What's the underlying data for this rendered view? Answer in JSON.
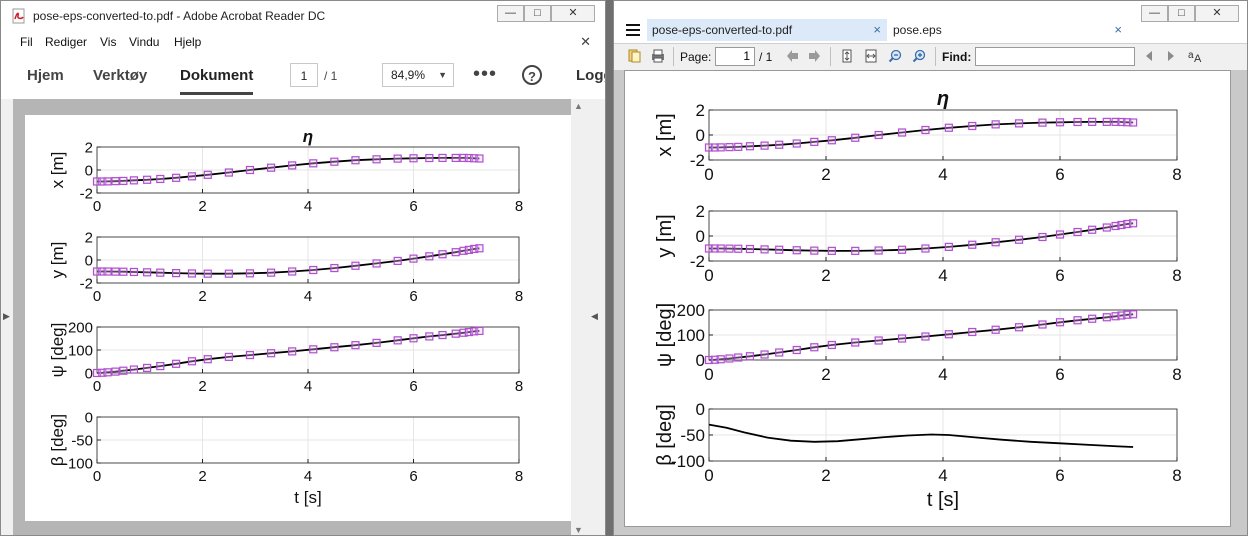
{
  "acrobat": {
    "title": "pose-eps-converted-to.pdf - Adobe Acrobat Reader DC",
    "menu": [
      "Fil",
      "Rediger",
      "Vis",
      "Vindu",
      "Hjelp"
    ],
    "nav": {
      "home": "Hjem",
      "tools": "Verktøy",
      "document": "Dokument"
    },
    "page_current": "1",
    "page_total": "/ 1",
    "zoom": "84,9%",
    "more": "•••",
    "help": "?",
    "login": "Logg"
  },
  "sumatra": {
    "tabs": [
      {
        "label": "pose-eps-converted-to.pdf",
        "close": "×"
      },
      {
        "label": "pose.eps",
        "close": "×"
      }
    ],
    "toolbar": {
      "page_label": "Page:",
      "page_current": "1",
      "page_total": "/ 1",
      "find_label": "Find:"
    }
  },
  "window_buttons": {
    "minimize": "—",
    "restore": "□",
    "close": "✕"
  },
  "colors": {
    "series_line": "#000000",
    "marker": "#b04fd0",
    "grid": "#e6e6e6"
  },
  "chart_data": [
    {
      "type": "line",
      "title": "η",
      "ylabel": "x [m]",
      "xlim": [
        0,
        8
      ],
      "ylim": [
        -2,
        2
      ],
      "xticks": [
        "0",
        "2",
        "4",
        "6",
        "8"
      ],
      "yticks": [
        "-2",
        "0",
        "2"
      ],
      "series": [
        {
          "x": [
            0,
            0.1,
            0.2,
            0.35,
            0.5,
            0.7,
            0.95,
            1.2,
            1.5,
            1.8,
            2.1,
            2.5,
            2.9,
            3.3,
            3.7,
            4.1,
            4.5,
            4.9,
            5.3,
            5.7,
            6.0,
            6.3,
            6.55,
            6.8,
            6.95,
            7.05,
            7.15,
            7.25
          ],
          "y": [
            -1.0,
            -1.0,
            -0.99,
            -0.97,
            -0.95,
            -0.9,
            -0.85,
            -0.78,
            -0.68,
            -0.55,
            -0.42,
            -0.22,
            0.0,
            0.2,
            0.4,
            0.58,
            0.72,
            0.85,
            0.93,
            0.99,
            1.02,
            1.04,
            1.05,
            1.05,
            1.05,
            1.04,
            1.02,
            1.0
          ]
        }
      ]
    },
    {
      "type": "line",
      "ylabel": "y [m]",
      "xlim": [
        0,
        8
      ],
      "ylim": [
        -2,
        2
      ],
      "xticks": [
        "0",
        "2",
        "4",
        "6",
        "8"
      ],
      "yticks": [
        "-2",
        "0",
        "2"
      ],
      "series": [
        {
          "x": [
            0,
            0.1,
            0.2,
            0.35,
            0.5,
            0.7,
            0.95,
            1.2,
            1.5,
            1.8,
            2.1,
            2.5,
            2.9,
            3.3,
            3.7,
            4.1,
            4.5,
            4.9,
            5.3,
            5.7,
            6.0,
            6.3,
            6.55,
            6.8,
            6.95,
            7.05,
            7.15,
            7.25
          ],
          "y": [
            -1.0,
            -1.0,
            -1.0,
            -1.01,
            -1.02,
            -1.04,
            -1.07,
            -1.1,
            -1.14,
            -1.17,
            -1.19,
            -1.19,
            -1.16,
            -1.1,
            -1.0,
            -0.87,
            -0.7,
            -0.5,
            -0.3,
            -0.08,
            0.12,
            0.32,
            0.5,
            0.68,
            0.8,
            0.88,
            0.96,
            1.02
          ]
        }
      ]
    },
    {
      "type": "line",
      "ylabel": "ψ [deg]",
      "xlim": [
        0,
        8
      ],
      "ylim": [
        0,
        200
      ],
      "xticks": [
        "0",
        "2",
        "4",
        "6",
        "8"
      ],
      "yticks": [
        "0",
        "100",
        "200"
      ],
      "series": [
        {
          "x": [
            0,
            0.1,
            0.2,
            0.35,
            0.5,
            0.7,
            0.95,
            1.2,
            1.5,
            1.8,
            2.1,
            2.5,
            2.9,
            3.3,
            3.7,
            4.1,
            4.5,
            4.9,
            5.3,
            5.7,
            6.0,
            6.3,
            6.55,
            6.8,
            6.95,
            7.05,
            7.15,
            7.25
          ],
          "y": [
            0,
            1,
            3,
            6,
            10,
            15,
            22,
            30,
            40,
            51,
            60,
            70,
            78,
            86,
            94,
            103,
            112,
            121,
            131,
            142,
            151,
            159,
            165,
            171,
            175,
            178,
            181,
            183
          ]
        }
      ]
    },
    {
      "type": "line",
      "ylabel": "β [deg]",
      "xlabel": "t [s]",
      "xlim": [
        0,
        8
      ],
      "ylim": [
        -100,
        0
      ],
      "xticks": [
        "0",
        "2",
        "4",
        "6",
        "8"
      ],
      "yticks": [
        "-100",
        "-50",
        "0"
      ],
      "series": [
        {
          "x": [
            0,
            0.3,
            0.6,
            1.0,
            1.4,
            1.8,
            2.2,
            2.6,
            3.0,
            3.4,
            3.8,
            4.1,
            4.5,
            5.0,
            5.5,
            6.0,
            6.5,
            7.0,
            7.25
          ],
          "y": [
            -30,
            -36,
            -45,
            -55,
            -61,
            -63,
            -62,
            -58,
            -54,
            -51,
            -49,
            -50,
            -54,
            -59,
            -63,
            -66,
            -69,
            -72,
            -73
          ]
        }
      ]
    }
  ]
}
